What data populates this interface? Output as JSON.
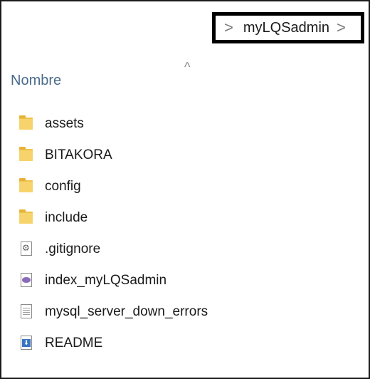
{
  "breadcrumb": {
    "prefix_chevron": ">",
    "current_folder": "myLQSadmin",
    "suffix_chevron": ">"
  },
  "header": {
    "sort_indicator": "^",
    "column_name": "Nombre"
  },
  "files": [
    {
      "name": "assets",
      "type": "folder",
      "icon": "folder-icon"
    },
    {
      "name": "BITAKORA",
      "type": "folder",
      "icon": "folder-icon"
    },
    {
      "name": "config",
      "type": "folder",
      "icon": "folder-icon"
    },
    {
      "name": "include",
      "type": "folder",
      "icon": "folder-icon"
    },
    {
      "name": ".gitignore",
      "type": "file",
      "icon": "settings-file-icon"
    },
    {
      "name": "index_myLQSadmin",
      "type": "file",
      "icon": "php-file-icon"
    },
    {
      "name": "mysql_server_down_errors",
      "type": "file",
      "icon": "text-file-icon"
    },
    {
      "name": "README",
      "type": "file",
      "icon": "markdown-file-icon"
    }
  ],
  "colors": {
    "folder": "#f0c14b",
    "column_header": "#4a6b8a",
    "highlight_border": "#000000"
  }
}
